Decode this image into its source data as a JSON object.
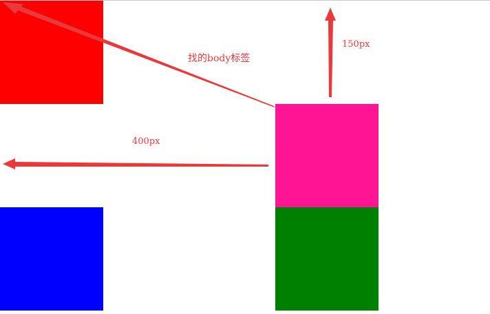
{
  "colors": {
    "red_box": "#ff0000",
    "pink_box": "#ff1493",
    "green_box": "#008000",
    "blue_box": "#0000ff",
    "annotation": "#e83a3a"
  },
  "annotations": {
    "body_tag": "找的body标签",
    "top_offset": "150px",
    "left_offset": "400px"
  }
}
